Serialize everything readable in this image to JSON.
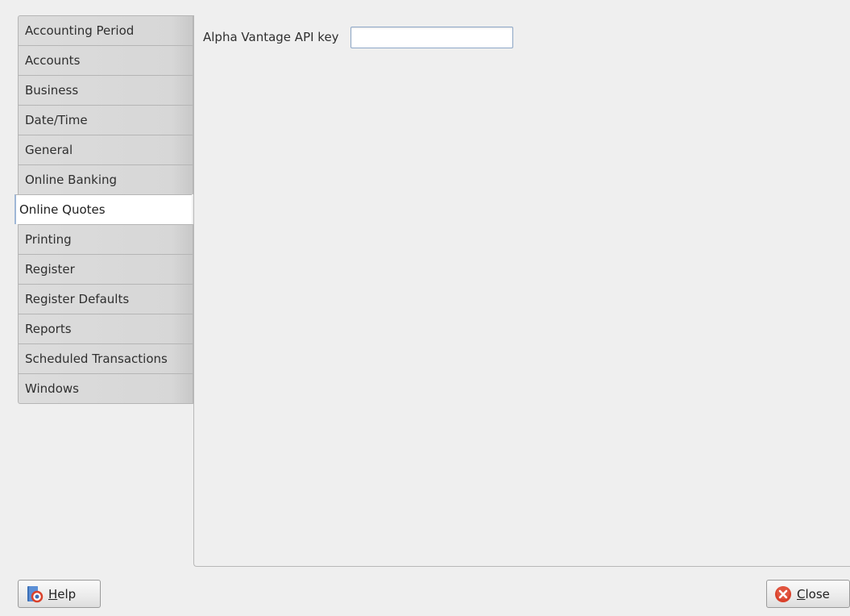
{
  "sidebar": {
    "tabs": [
      {
        "label": "Accounting Period"
      },
      {
        "label": "Accounts"
      },
      {
        "label": "Business"
      },
      {
        "label": "Date/Time"
      },
      {
        "label": "General"
      },
      {
        "label": "Online Banking"
      },
      {
        "label": "Online Quotes",
        "active": true
      },
      {
        "label": "Printing"
      },
      {
        "label": "Register"
      },
      {
        "label": "Register Defaults"
      },
      {
        "label": "Reports"
      },
      {
        "label": "Scheduled Transactions"
      },
      {
        "label": "Windows"
      }
    ]
  },
  "content": {
    "api_key": {
      "label": "Alpha Vantage API key",
      "value": ""
    }
  },
  "buttons": {
    "help": {
      "mnemonic": "H",
      "rest": "elp",
      "icon": "help-icon"
    },
    "close": {
      "mnemonic": "C",
      "rest": "lose",
      "icon": "close-icon"
    }
  },
  "colors": {
    "active_tab_accent": "#9fb7d6",
    "close_icon_red": "#d9412b",
    "help_icon_blue": "#3b6fb6"
  }
}
